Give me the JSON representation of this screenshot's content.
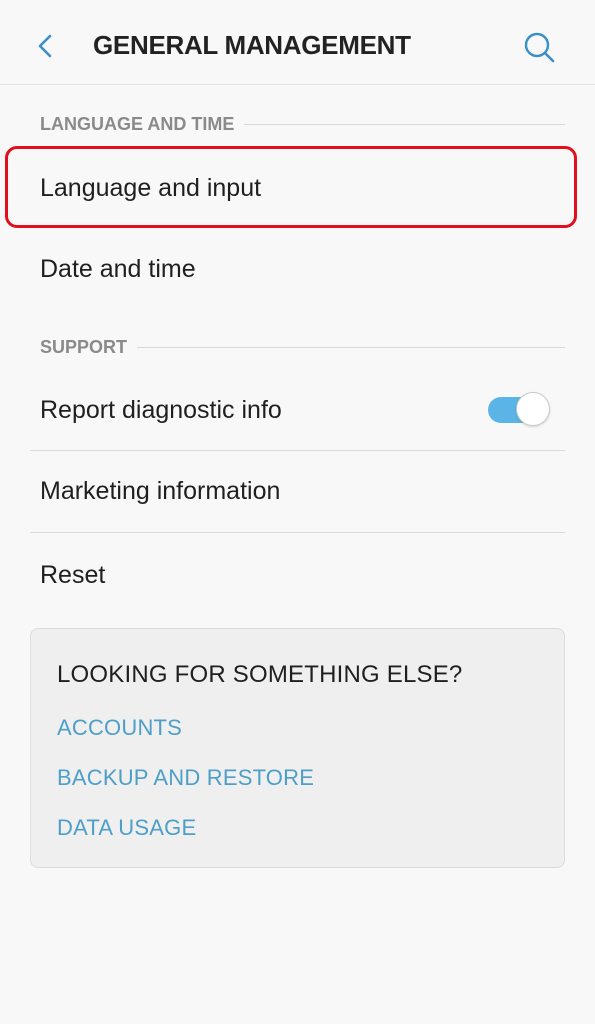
{
  "header": {
    "title": "GENERAL MANAGEMENT",
    "back_icon": "chevron-left-icon",
    "search_icon": "search-icon",
    "accent_color": "#3a8fc7"
  },
  "sections": {
    "language_time": {
      "header": "LANGUAGE AND TIME",
      "items": [
        "Language and input",
        "Date and time"
      ]
    },
    "support": {
      "header": "SUPPORT",
      "items": [
        "Report diagnostic info",
        "Marketing information",
        "Reset"
      ]
    }
  },
  "toggles": {
    "report_diagnostic_info": {
      "on": true,
      "color": "#5ab5e6"
    }
  },
  "highlight": {
    "target": "Language and input",
    "color": "#e0101e"
  },
  "suggestions": {
    "title": "LOOKING FOR SOMETHING ELSE?",
    "links": [
      "ACCOUNTS",
      "BACKUP AND RESTORE",
      "DATA USAGE"
    ],
    "link_color": "#4e9fc8"
  }
}
